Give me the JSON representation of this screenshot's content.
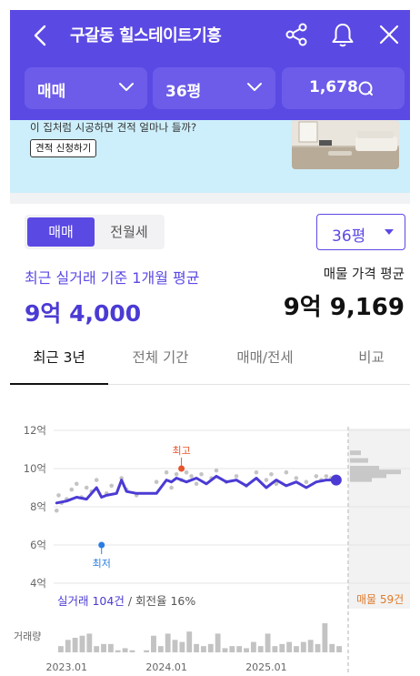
{
  "header": {
    "title": "구갈동 힐스테이트기흥",
    "dropdowns": [
      {
        "label": "매매"
      },
      {
        "label": "36평"
      },
      {
        "label": "1,678"
      }
    ]
  },
  "banner": {
    "text": "이 집처럼 시공하면 견적 얼마나 들까?",
    "button_label": "견적 신청하기"
  },
  "deal_toggle": {
    "active": "매매",
    "inactive": "전월세"
  },
  "size_select": {
    "label": "36평"
  },
  "summary": {
    "recent_label": "최근 실거래 기준 1개월 평균",
    "recent_value": "9억 4,000",
    "listing_label": "매물 가격 평균",
    "listing_value": "9억 9,169"
  },
  "tabs": [
    "최근 3년",
    "전체 기간",
    "매매/전세",
    "비교"
  ],
  "chart_meta": {
    "stats_count": "실거래 104건",
    "stats_rate": " / 회전율 16%",
    "listings": "매물 59건",
    "max_label": "최고",
    "min_label": "최저",
    "volume_label": "거래량"
  },
  "colors": {
    "accent": "#5b49e4",
    "line": "#4b3bd4",
    "max_marker": "#e8542d",
    "min_marker": "#2a7de1",
    "listing": "#e07b2a"
  },
  "chart_data": {
    "type": "line",
    "ylim": [
      4,
      12
    ],
    "y_ticks": [
      "12억",
      "10억",
      "8억",
      "6억",
      "4억"
    ],
    "y_tick_values": [
      12,
      10,
      8,
      6,
      4
    ],
    "x_ticks": [
      "2023.01",
      "2024.01",
      "2025.01"
    ],
    "x_tick_values": [
      2023.0,
      2024.0,
      2025.0
    ],
    "series": [
      {
        "x": [
          2022.9,
          2023.0,
          2023.1,
          2023.2,
          2023.3,
          2023.35,
          2023.4,
          2023.5,
          2023.55,
          2023.6,
          2023.7,
          2023.8,
          2023.9,
          2024.0,
          2024.05,
          2024.1,
          2024.2,
          2024.3,
          2024.4,
          2024.5,
          2024.6,
          2024.7,
          2024.8,
          2024.9,
          2025.0,
          2025.1,
          2025.2,
          2025.3,
          2025.4,
          2025.5,
          2025.6,
          2025.7
        ],
        "values": [
          8.2,
          8.3,
          8.5,
          8.4,
          9.0,
          8.5,
          8.6,
          8.7,
          9.4,
          8.8,
          8.7,
          8.7,
          8.7,
          9.4,
          9.3,
          9.5,
          9.3,
          9.5,
          9.2,
          9.6,
          9.3,
          9.4,
          9.1,
          9.5,
          9.0,
          9.4,
          9.1,
          9.3,
          9.0,
          9.3,
          9.4,
          9.4
        ]
      }
    ],
    "scatter": {
      "x": [
        2022.9,
        2022.92,
        2022.95,
        2023.0,
        2023.05,
        2023.1,
        2023.15,
        2023.2,
        2023.25,
        2023.3,
        2023.4,
        2023.45,
        2023.55,
        2023.6,
        2023.7,
        2023.9,
        2024.0,
        2024.05,
        2024.1,
        2024.15,
        2024.2,
        2024.25,
        2024.3,
        2024.35,
        2024.45,
        2024.5,
        2024.6,
        2024.7,
        2024.8,
        2024.9,
        2025.0,
        2025.05,
        2025.1,
        2025.2,
        2025.3,
        2025.4,
        2025.5,
        2025.55,
        2025.6,
        2025.65
      ],
      "values": [
        7.8,
        8.6,
        8.2,
        8.4,
        8.9,
        9.2,
        8.5,
        9.0,
        8.8,
        9.4,
        8.7,
        9.1,
        9.5,
        8.9,
        8.6,
        9.3,
        9.8,
        9.0,
        9.7,
        9.4,
        9.8,
        9.6,
        9.2,
        9.7,
        9.5,
        9.9,
        9.3,
        9.6,
        9.1,
        9.8,
        9.4,
        9.7,
        9.2,
        9.8,
        9.5,
        9.3,
        9.6,
        9.4,
        9.6,
        9.5
      ]
    },
    "max_point": {
      "x": 2024.15,
      "value": 10.0
    },
    "min_point": {
      "x": 2023.35,
      "value": 6.0
    },
    "listing_distribution": [
      {
        "value": 10.8,
        "count": 3
      },
      {
        "value": 10.4,
        "count": 5
      },
      {
        "value": 10.0,
        "count": 8
      },
      {
        "value": 9.8,
        "count": 14
      },
      {
        "value": 9.6,
        "count": 10
      },
      {
        "value": 9.4,
        "count": 6
      }
    ],
    "volume": [
      3,
      6,
      7,
      8,
      9,
      3,
      4,
      4,
      1,
      2,
      1,
      0,
      1,
      8,
      3,
      9,
      6,
      5,
      10,
      4,
      3,
      4,
      9,
      2,
      3,
      3,
      2,
      5,
      3,
      9,
      3,
      4,
      5,
      3,
      5,
      6,
      4,
      14,
      4,
      3
    ]
  }
}
